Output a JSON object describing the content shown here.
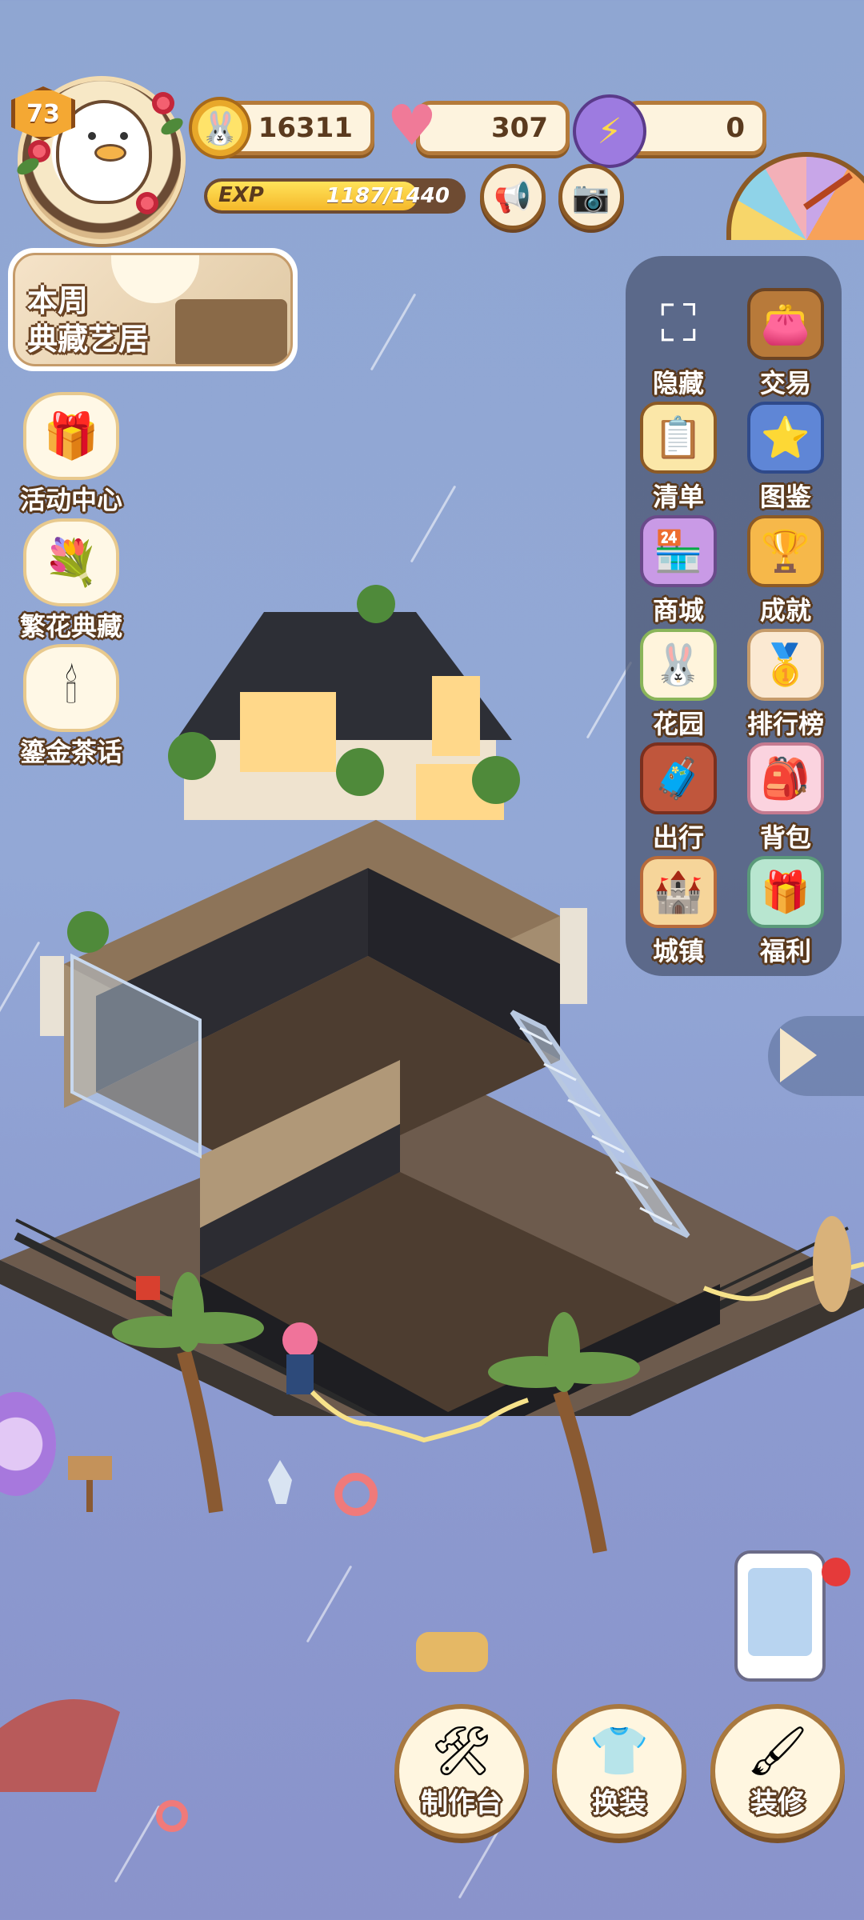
{
  "player": {
    "level": "73",
    "avatar_icon": "goose-avatar"
  },
  "currencies": {
    "coins": {
      "value": "16311",
      "icon": "rabbit-coin-icon"
    },
    "hearts": {
      "value": "307",
      "icon": "heart-gem-icon"
    },
    "energy": {
      "value": "0",
      "icon": "purple-glove-icon"
    }
  },
  "exp": {
    "label": "EXP",
    "current": 1187,
    "max": 1440,
    "text": "1187/1440"
  },
  "weekly": {
    "line1": "本周",
    "line2": "典藏艺居"
  },
  "left_menu": [
    {
      "label": "活动中心",
      "icon": "gift-box-icon"
    },
    {
      "label": "繁花典藏",
      "icon": "flower-icon"
    },
    {
      "label": "鎏金茶话",
      "icon": "chandelier-icon"
    }
  ],
  "side_menu": [
    {
      "label": "隐藏",
      "icon": "expand-corners-icon"
    },
    {
      "label": "交易",
      "icon": "wallet-icon"
    },
    {
      "label": "清单",
      "icon": "checklist-icon"
    },
    {
      "label": "图鉴",
      "icon": "star-book-icon"
    },
    {
      "label": "商城",
      "icon": "shop-icon"
    },
    {
      "label": "成就",
      "icon": "trophy-star-icon"
    },
    {
      "label": "花园",
      "icon": "garden-icon"
    },
    {
      "label": "排行榜",
      "icon": "podium-icon"
    },
    {
      "label": "出行",
      "icon": "suitcase-icon"
    },
    {
      "label": "背包",
      "icon": "bag-icon"
    },
    {
      "label": "城镇",
      "icon": "castle-icon"
    },
    {
      "label": "福利",
      "icon": "present-icon"
    }
  ],
  "bottom_menu": [
    {
      "label": "制作台",
      "icon": "workbench-icon"
    },
    {
      "label": "换装",
      "icon": "outfit-icon"
    },
    {
      "label": "装修",
      "icon": "decorate-icon"
    }
  ],
  "colors": {
    "accent": "#f5b82a",
    "panel": "#46526e",
    "outline": "#5a3a1e"
  }
}
